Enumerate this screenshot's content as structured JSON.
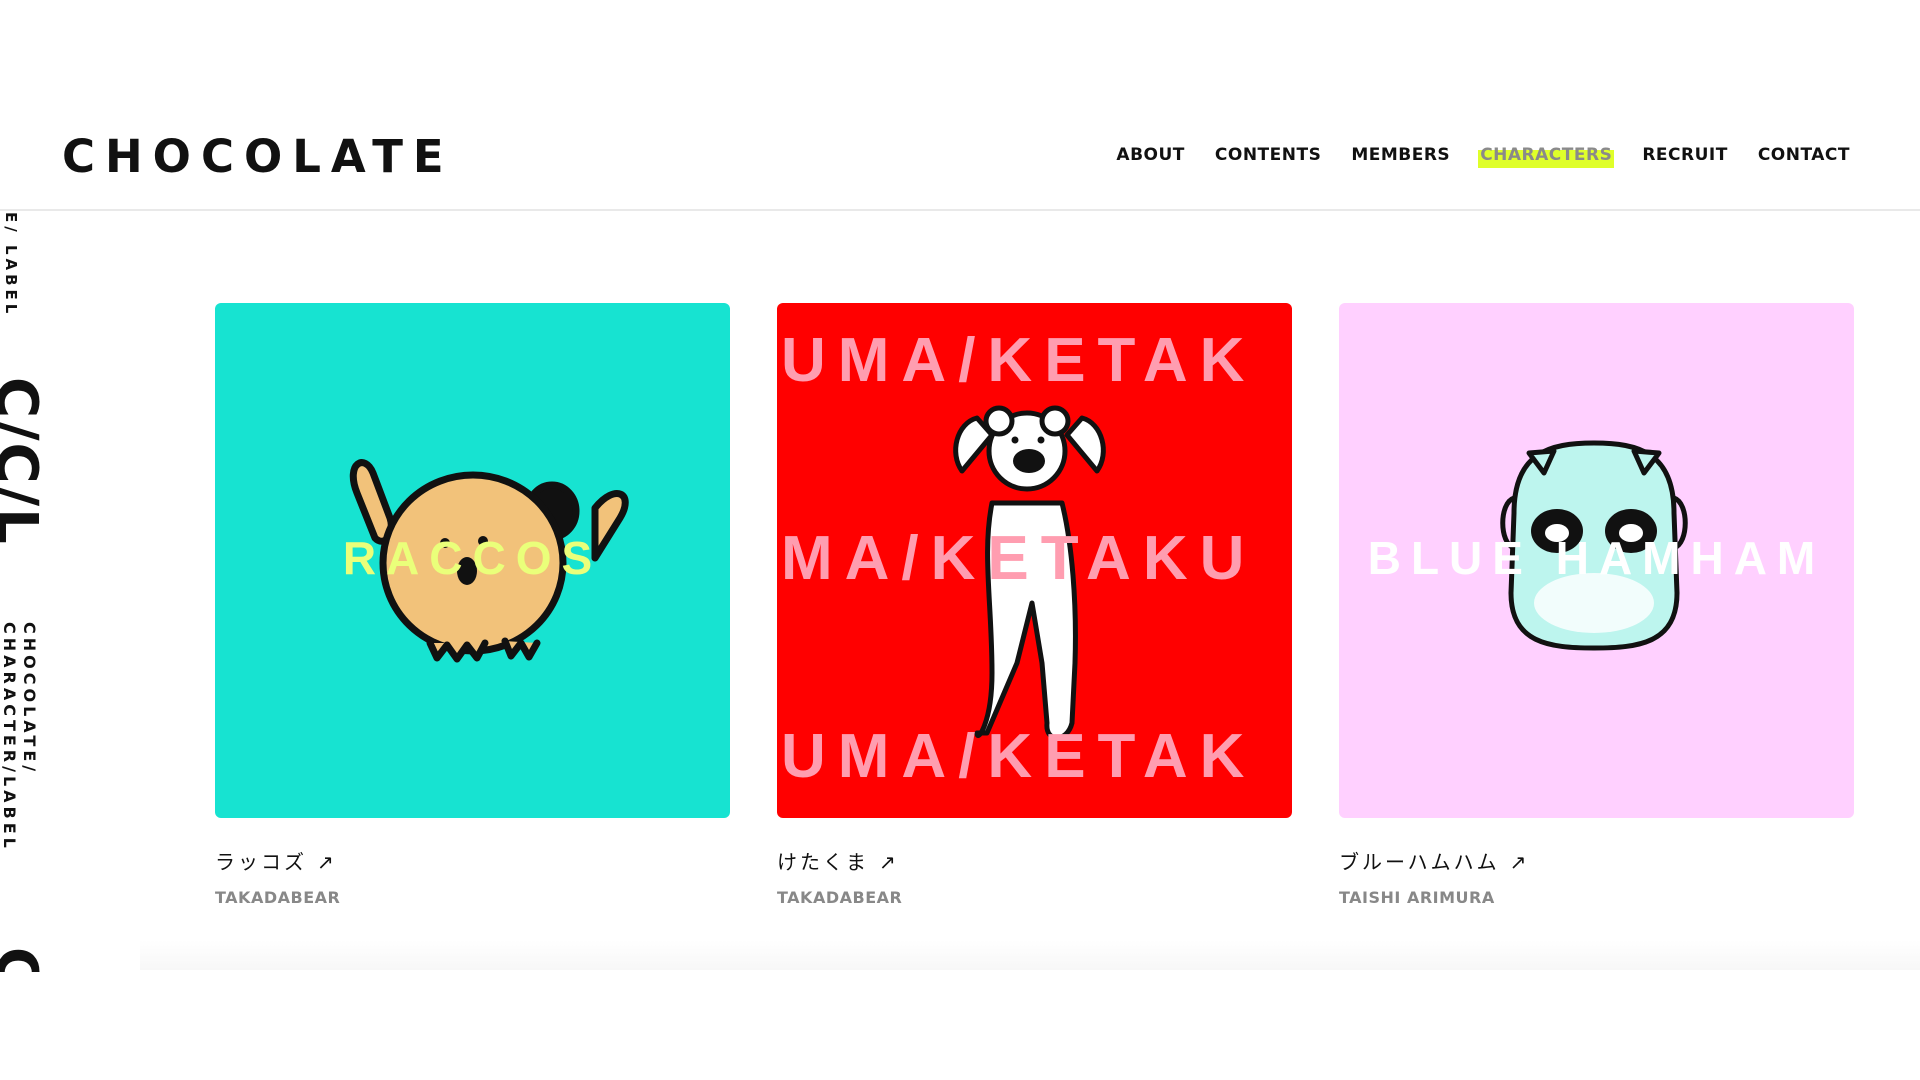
{
  "site": {
    "logo": "CHOCOLATE"
  },
  "nav": {
    "items": [
      {
        "label": "ABOUT"
      },
      {
        "label": "CONTENTS"
      },
      {
        "label": "MEMBERS"
      },
      {
        "label": "CHARACTERS"
      },
      {
        "label": "RECRUIT"
      },
      {
        "label": "CONTACT"
      }
    ],
    "active": "CHARACTERS",
    "active_highlight_color": "#dfff2a"
  },
  "side_label": {
    "top_text": "E/ LABEL",
    "big_text": "C/C/L",
    "line1": "CHOCOLATE/",
    "line2": "CHARACTER/LABEL",
    "bottom_text": "C"
  },
  "cards": [
    {
      "title": "ラッコズ",
      "author": "TAKADABEAR",
      "overlay_text": "RACCOS",
      "bg_color": "#17e3d1",
      "overlay_color": "#eaff7a",
      "icon": "raccoon-character-icon"
    },
    {
      "title": "けたくま",
      "author": "TAKADABEAR",
      "overlay_lines": [
        "UMA/KETAK",
        "MA/KETAKU",
        "UMA/KETAK"
      ],
      "bg_color": "#ff0000",
      "overlay_color": "#ff9db0",
      "icon": "bear-character-icon"
    },
    {
      "title": "ブルーハムハム",
      "author": "TAISHI ARIMURA",
      "overlay_text": "BLUE HAMHAM",
      "bg_color": "#ffd0ff",
      "overlay_color": "#ffffff",
      "icon": "hamster-character-icon"
    }
  ],
  "arrow_glyph": "↗"
}
